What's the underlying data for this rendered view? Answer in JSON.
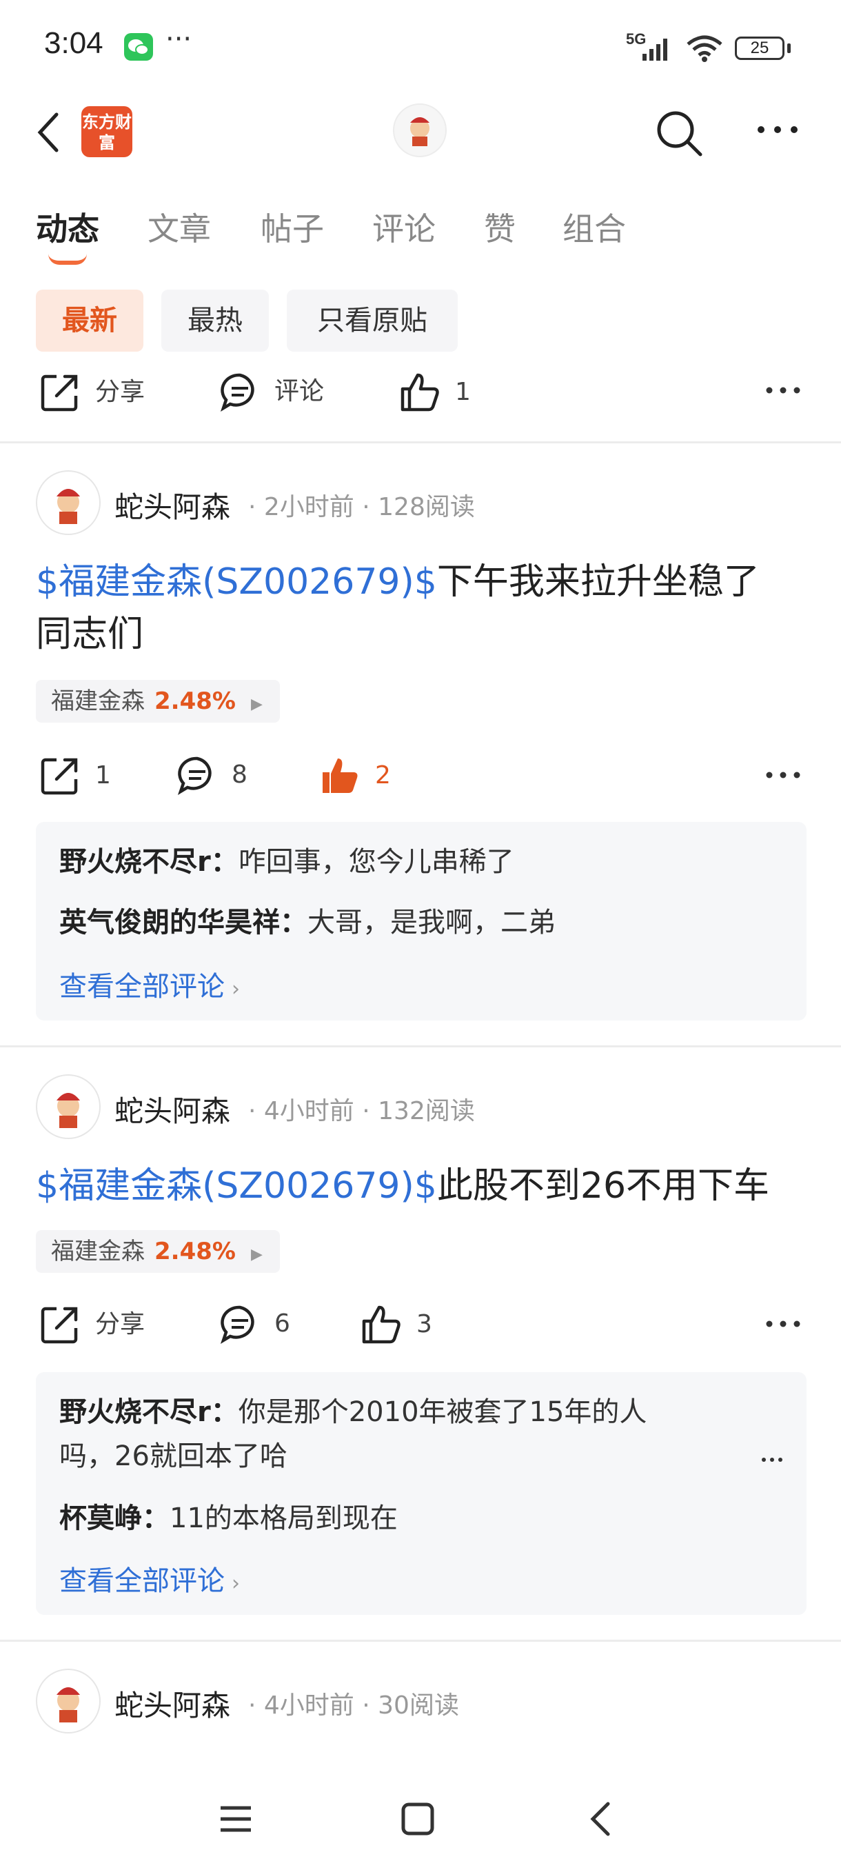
{
  "status_bar": {
    "time": "3:04",
    "more": "···",
    "network": "5G",
    "battery": "25"
  },
  "header": {
    "logo_text": "东方财富"
  },
  "tabs": [
    {
      "label": "动态"
    },
    {
      "label": "文章"
    },
    {
      "label": "帖子"
    },
    {
      "label": "评论"
    },
    {
      "label": "赞"
    },
    {
      "label": "组合"
    }
  ],
  "filters": [
    {
      "label": "最新"
    },
    {
      "label": "最热"
    },
    {
      "label": "只看原贴"
    }
  ],
  "top_actions": {
    "share": "分享",
    "comment": "评论",
    "likes": "1"
  },
  "posts": [
    {
      "author": "蛇头阿森",
      "time": "2小时前",
      "reads": "128阅读",
      "stock_tag": "$福建金森(SZ002679)$",
      "text_line1": "下午我来拉升坐稳了",
      "text_line2": "同志们",
      "chip_name": "福建金森",
      "chip_pct": "2.48%",
      "shares": "1",
      "comments": "8",
      "likes": "2",
      "comments_preview": [
        {
          "user": "野火烧不尽r：",
          "text": "咋回事，您今儿串稀了"
        },
        {
          "user": "英气俊朗的华昊祥：",
          "text": "大哥，是我啊，二弟"
        }
      ],
      "view_all": "查看全部评论"
    },
    {
      "author": "蛇头阿森",
      "time": "4小时前",
      "reads": "132阅读",
      "stock_tag": "$福建金森(SZ002679)$",
      "text_line1": "此股不到26不用下车",
      "chip_name": "福建金森",
      "chip_pct": "2.48%",
      "share_label": "分享",
      "comments": "6",
      "likes": "3",
      "comments_preview": [
        {
          "user": "野火烧不尽r：",
          "text": "你是那个2010年被套了15年的人",
          "text2": "吗，26就回本了哈"
        },
        {
          "user": "杯莫峥：",
          "text": "11的本格局到现在"
        }
      ],
      "view_all": "查看全部评论"
    },
    {
      "author": "蛇头阿森",
      "time": "4小时前",
      "reads": "30阅读"
    }
  ],
  "colors": {
    "accent": "#e2561e",
    "link": "#2f6fd6"
  }
}
